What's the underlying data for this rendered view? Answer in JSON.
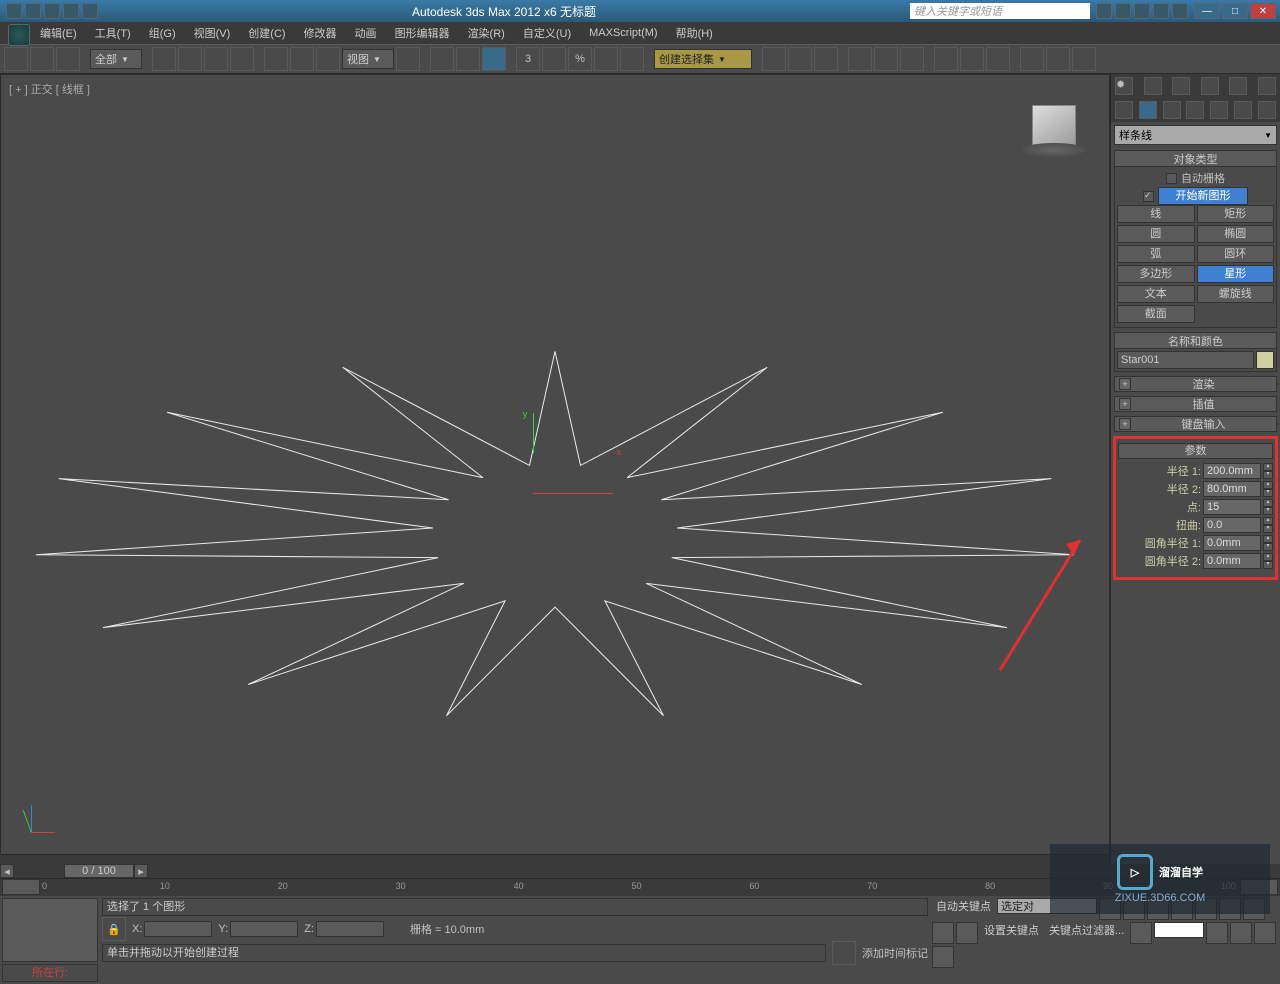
{
  "title": "Autodesk 3ds Max 2012 x6    无标题",
  "search_placeholder": "键入关键字或短语",
  "menus": [
    "编辑(E)",
    "工具(T)",
    "组(G)",
    "视图(V)",
    "创建(C)",
    "修改器",
    "动画",
    "图形编辑器",
    "渲染(R)",
    "自定义(U)",
    "MAXScript(M)",
    "帮助(H)"
  ],
  "toolbar": {
    "all_dropdown": "全部",
    "view_dropdown": "视图",
    "selection_set": "创建选择集"
  },
  "viewport": {
    "label": "[ + ] 正交 [ 线框 ]"
  },
  "sidebar": {
    "category_dropdown": "样条线",
    "object_type_header": "对象类型",
    "auto_grid": "自动栅格",
    "start_new_shape": "开始新图形",
    "shapes": [
      [
        "线",
        "矩形"
      ],
      [
        "圆",
        "椭圆"
      ],
      [
        "弧",
        "圆环"
      ],
      [
        "多边形",
        "星形"
      ],
      [
        "文本",
        "螺旋线"
      ],
      [
        "截面",
        ""
      ]
    ],
    "active_shape": "星形",
    "name_color_header": "名称和颜色",
    "object_name": "Star001",
    "render_header": "渲染",
    "interpolation_header": "插值",
    "keyboard_header": "键盘输入",
    "params_header": "参数",
    "params": {
      "radius1_label": "半径 1:",
      "radius1_value": "200.0mm",
      "radius2_label": "半径 2:",
      "radius2_value": "80.0mm",
      "points_label": "点:",
      "points_value": "15",
      "distort_label": "扭曲:",
      "distort_value": "0.0",
      "fillet1_label": "圆角半径 1:",
      "fillet1_value": "0.0mm",
      "fillet2_label": "圆角半径 2:",
      "fillet2_value": "0.0mm"
    }
  },
  "timeline": {
    "slider_label": "0 / 100",
    "ticks": [
      "0",
      "10",
      "20",
      "30",
      "40",
      "50",
      "60",
      "70",
      "80",
      "90",
      "100"
    ]
  },
  "status": {
    "red_text": "所在行:",
    "selection_text": "选择了 1 个图形",
    "hint_text": "单击并拖动以开始创建过程",
    "grid_text": "栅格 = 10.0mm",
    "auto_key": "自动关键点",
    "set_key": "设置关键点",
    "key_filter": "关键点过滤器...",
    "add_time_tag": "添加时间标记",
    "select_obj": "选定对"
  },
  "watermark": {
    "main": "溜溜自学",
    "sub": "ZIXUE.3D66.COM"
  }
}
